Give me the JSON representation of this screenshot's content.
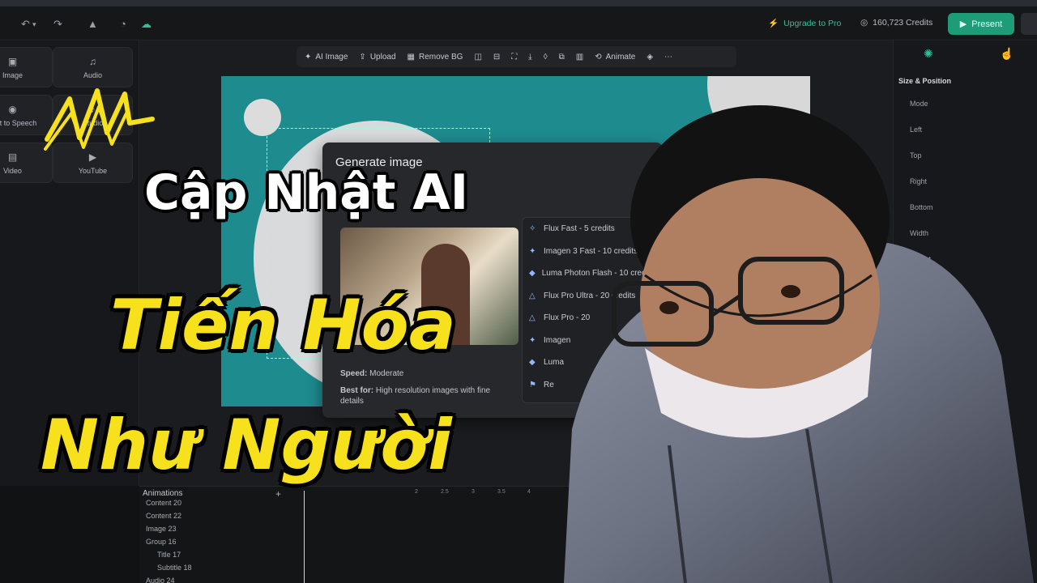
{
  "topbar": {
    "upgrade_label": "Upgrade to Pro",
    "credits_label": "160,723 Credits",
    "present_label": "Present"
  },
  "left_tiles": [
    {
      "label": "Image",
      "icon": "image-icon"
    },
    {
      "label": "Audio",
      "icon": "audio-icon"
    },
    {
      "label": "Text to Speech",
      "icon": "speech-icon"
    },
    {
      "label": "Studio",
      "icon": "studio-icon"
    },
    {
      "label": "Video",
      "icon": "video-icon"
    },
    {
      "label": "YouTube",
      "icon": "youtube-icon"
    }
  ],
  "toolbar": {
    "ai_image": "AI Image",
    "upload": "Upload",
    "remove_bg": "Remove BG",
    "animate": "Animate"
  },
  "modal": {
    "title": "Generate image",
    "speed_label": "Speed:",
    "speed_value": "Moderate",
    "best_label": "Best for:",
    "best_value": "High resolution images with fine details"
  },
  "models": [
    "Flux Fast - 5 credits",
    "Imagen 3 Fast - 10 credits",
    "Luma Photon Flash - 10 credits",
    "Flux Pro Ultra - 20 credits",
    "Flux Pro - 20",
    "Imagen",
    "Luma",
    "Re"
  ],
  "right_panel": {
    "title": "Size & Position",
    "labels": [
      "Mode",
      "Left",
      "Top",
      "Right",
      "Bottom",
      "Width",
      "Height"
    ]
  },
  "timeline": {
    "title": "Animations",
    "layers": [
      "Content 20",
      "Content 22",
      "Image 23",
      "Group 16",
      "Title 17",
      "Subtitle 18",
      "Audio 24"
    ],
    "ticks": [
      "2",
      "2.5",
      "3",
      "3.5",
      "4"
    ]
  },
  "overlay": {
    "line1": "Cập Nhật AI",
    "line2": "Tiến Hóa",
    "line3": "Như Người"
  },
  "colors": {
    "accent_green": "#1e9c78",
    "slide_teal": "#1e8b8f",
    "title_yellow": "#f7e11c"
  }
}
